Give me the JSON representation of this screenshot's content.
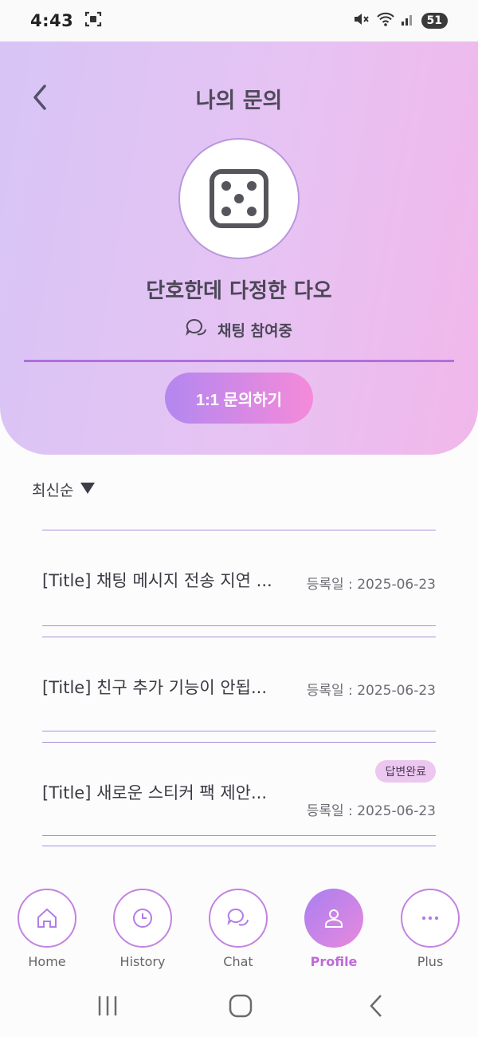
{
  "status_bar": {
    "time": "4:43",
    "battery": "51"
  },
  "header": {
    "title": "나의 문의",
    "profile_name": "단호한데 다정한 다오",
    "chat_status": "채팅 참여중",
    "inquiry_button": "1:1 문의하기"
  },
  "sort": {
    "label": "최신순"
  },
  "inquiries": [
    {
      "title": "[Title] 채팅 메시지 전송 지연 ...",
      "date": "등록일 : 2025-06-23",
      "badge": ""
    },
    {
      "title": "[Title] 친구 추가 기능이 안됩...",
      "date": "등록일 : 2025-06-23",
      "badge": ""
    },
    {
      "title": "[Title] 새로운 스티커 팩 제안...",
      "date": "등록일 : 2025-06-23",
      "badge": "답변완료"
    }
  ],
  "bottom_nav": [
    {
      "label": "Home",
      "icon": "home-icon",
      "active": false
    },
    {
      "label": "History",
      "icon": "clock-icon",
      "active": false
    },
    {
      "label": "Chat",
      "icon": "chat-bubbles-icon",
      "active": false
    },
    {
      "label": "Profile",
      "icon": "person-icon",
      "active": true
    },
    {
      "label": "Plus",
      "icon": "more-dots-icon",
      "active": false
    }
  ],
  "colors": {
    "accent": "#c06ad8",
    "gradient_start": "#b387f0",
    "gradient_end": "#f58ad9"
  }
}
